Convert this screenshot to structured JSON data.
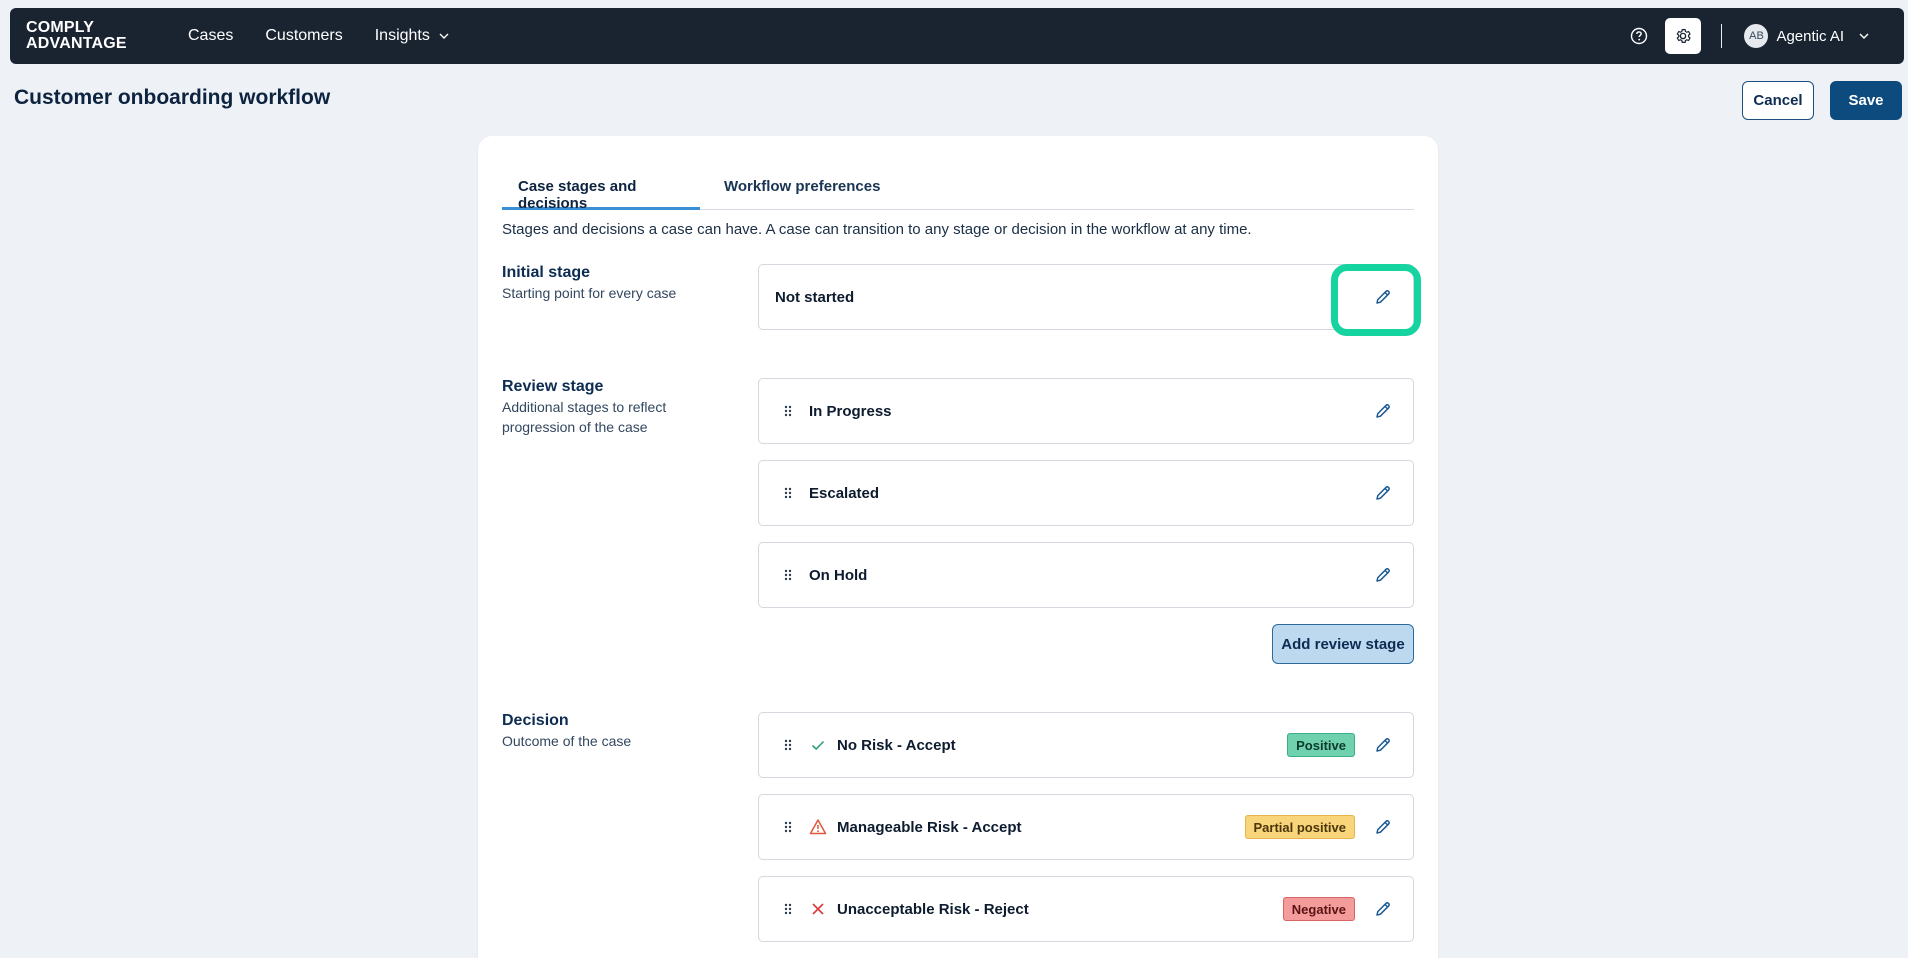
{
  "nav": {
    "logo_line1": "COMPLY",
    "logo_line2": "ADVANTAGE",
    "items": [
      {
        "label": "Cases"
      },
      {
        "label": "Customers"
      },
      {
        "label": "Insights"
      }
    ],
    "user": {
      "initials": "AB",
      "name": "Agentic AI"
    }
  },
  "header": {
    "title": "Customer onboarding workflow",
    "cancel_label": "Cancel",
    "save_label": "Save"
  },
  "tabs": [
    {
      "label": "Case stages and decisions",
      "active": true
    },
    {
      "label": "Workflow preferences",
      "active": false
    }
  ],
  "intro": "Stages and decisions a case can have. A case can transition to any stage or decision in the workflow at any time.",
  "initial_stage": {
    "heading": "Initial stage",
    "subtitle": "Starting point for every case",
    "value": "Not started"
  },
  "review_stage": {
    "heading": "Review stage",
    "subtitle": "Additional stages to reflect progression of the case",
    "items": [
      {
        "label": "In Progress"
      },
      {
        "label": "Escalated"
      },
      {
        "label": "On Hold"
      }
    ],
    "add_label": "Add review stage"
  },
  "decision": {
    "heading": "Decision",
    "subtitle": "Outcome of the case",
    "items": [
      {
        "label": "No Risk - Accept",
        "badge": "Positive",
        "icon": "check-icon",
        "color": "#2f9f78"
      },
      {
        "label": "Manageable Risk - Accept",
        "badge": "Partial positive",
        "icon": "warning-icon",
        "color": "#e0573c"
      },
      {
        "label": "Unacceptable Risk - Reject",
        "badge": "Negative",
        "icon": "close-icon",
        "color": "#d93a3a"
      }
    ]
  },
  "colors": {
    "nav_bg": "#1a2431",
    "primary": "#0d4b7e",
    "highlight": "#16d4a0"
  }
}
